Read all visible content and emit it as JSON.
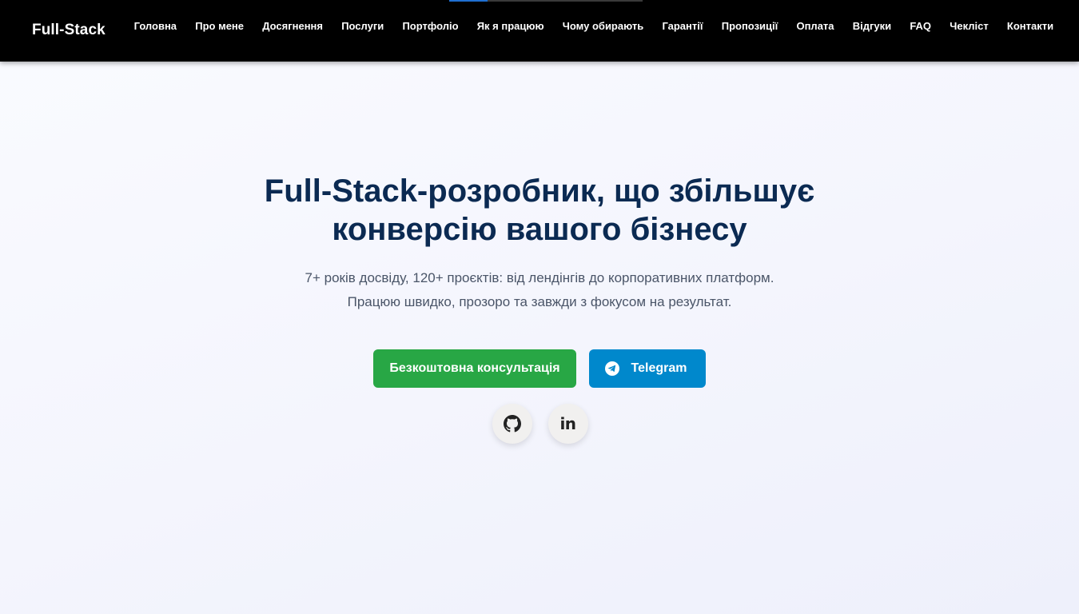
{
  "header": {
    "brand": "Full-Stack",
    "scroll_progress": 0.2,
    "nav": [
      {
        "id": "home",
        "label": "Головна"
      },
      {
        "id": "about",
        "label": "Про мене"
      },
      {
        "id": "achievements",
        "label": "Досягнення"
      },
      {
        "id": "services",
        "label": "Послуги"
      },
      {
        "id": "portfolio",
        "label": "Портфоліо"
      },
      {
        "id": "process",
        "label": "Як я працюю"
      },
      {
        "id": "why",
        "label": "Чому обирають"
      },
      {
        "id": "guarantees",
        "label": "Гарантії"
      },
      {
        "id": "offers",
        "label": "Пропозиції"
      },
      {
        "id": "payment",
        "label": "Оплата"
      },
      {
        "id": "reviews",
        "label": "Відгуки"
      },
      {
        "id": "faq",
        "label": "FAQ"
      },
      {
        "id": "checklist",
        "label": "Чекліст"
      },
      {
        "id": "contacts",
        "label": "Контакти"
      }
    ]
  },
  "hero": {
    "title_line1": "Full-Stack-розробник, що збільшує",
    "title_line2": "конверсію вашого бізнесу",
    "subtitle_line1": "7+ років досвіду, 120+ проєктів: від лендінгів до корпоративних платформ.",
    "subtitle_line2": "Працюю швидко, прозоро та завжди з фокусом на результат.",
    "cta_primary": "Безкоштовна консультація",
    "cta_secondary": "Telegram",
    "social": [
      {
        "name": "github-icon"
      },
      {
        "name": "linkedin-icon",
        "text": "in"
      }
    ]
  },
  "colors": {
    "header_bg": "#000000",
    "title": "#0b2a52",
    "primary_button": "#28a745",
    "telegram_button": "#0088cc"
  }
}
